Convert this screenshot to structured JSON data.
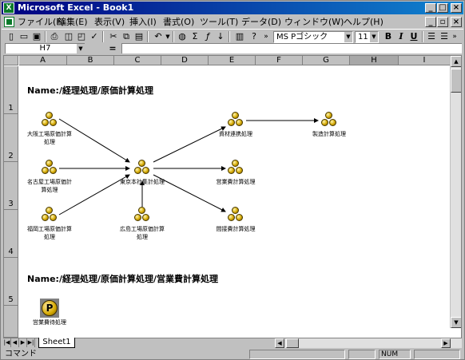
{
  "window": {
    "title": "Microsoft Excel - Book1",
    "app_icon": "X",
    "controls": [
      "_",
      "□",
      "×"
    ]
  },
  "menu": {
    "items": [
      "ファイル(F)",
      "編集(E)",
      "表示(V)",
      "挿入(I)",
      "書式(O)",
      "ツール(T)",
      "データ(D)",
      "ウィンドウ(W)",
      "ヘルプ(H)"
    ],
    "mdi_controls": [
      "_",
      "▫",
      "×"
    ]
  },
  "toolbar": {
    "font_name": "MS Pゴシック",
    "font_size": "11",
    "bold": "B",
    "italic": "I",
    "underline": "U"
  },
  "formula_bar": {
    "cell_ref": "H7",
    "equals": "=",
    "value": ""
  },
  "columns": [
    "A",
    "B",
    "C",
    "D",
    "E",
    "F",
    "G",
    "H",
    "I"
  ],
  "selected_column": "H",
  "rows": [
    "1",
    "2",
    "3",
    "4",
    "5"
  ],
  "sheet": {
    "title1": "Name:/経理処理/原価計算処理",
    "title2": "Name:/経理処理/原価計算処理/営業費計算処理",
    "nodes": [
      {
        "id": "osaka",
        "label": "大阪工場原価計算処理"
      },
      {
        "id": "nagoya",
        "label": "名古屋工場原価計算処理"
      },
      {
        "id": "fukuoka",
        "label": "福岡工場原価計算処理"
      },
      {
        "id": "tokyo",
        "label": "東京本社集計処理"
      },
      {
        "id": "hiroshima",
        "label": "広島工場原価計算処理"
      },
      {
        "id": "shizai",
        "label": "資材連携処理"
      },
      {
        "id": "eigyo",
        "label": "営業費計算処理"
      },
      {
        "id": "kansetsu",
        "label": "間接費計算処理"
      },
      {
        "id": "seizo",
        "label": "製造計算処理"
      },
      {
        "id": "eigyohi",
        "label": "営業費待処理"
      }
    ]
  },
  "tabs": {
    "nav": [
      "|◀",
      "◀",
      "▶",
      "▶|"
    ],
    "sheet_name": "Sheet1"
  },
  "status": {
    "mode": "コマンド",
    "num": "NUM"
  }
}
